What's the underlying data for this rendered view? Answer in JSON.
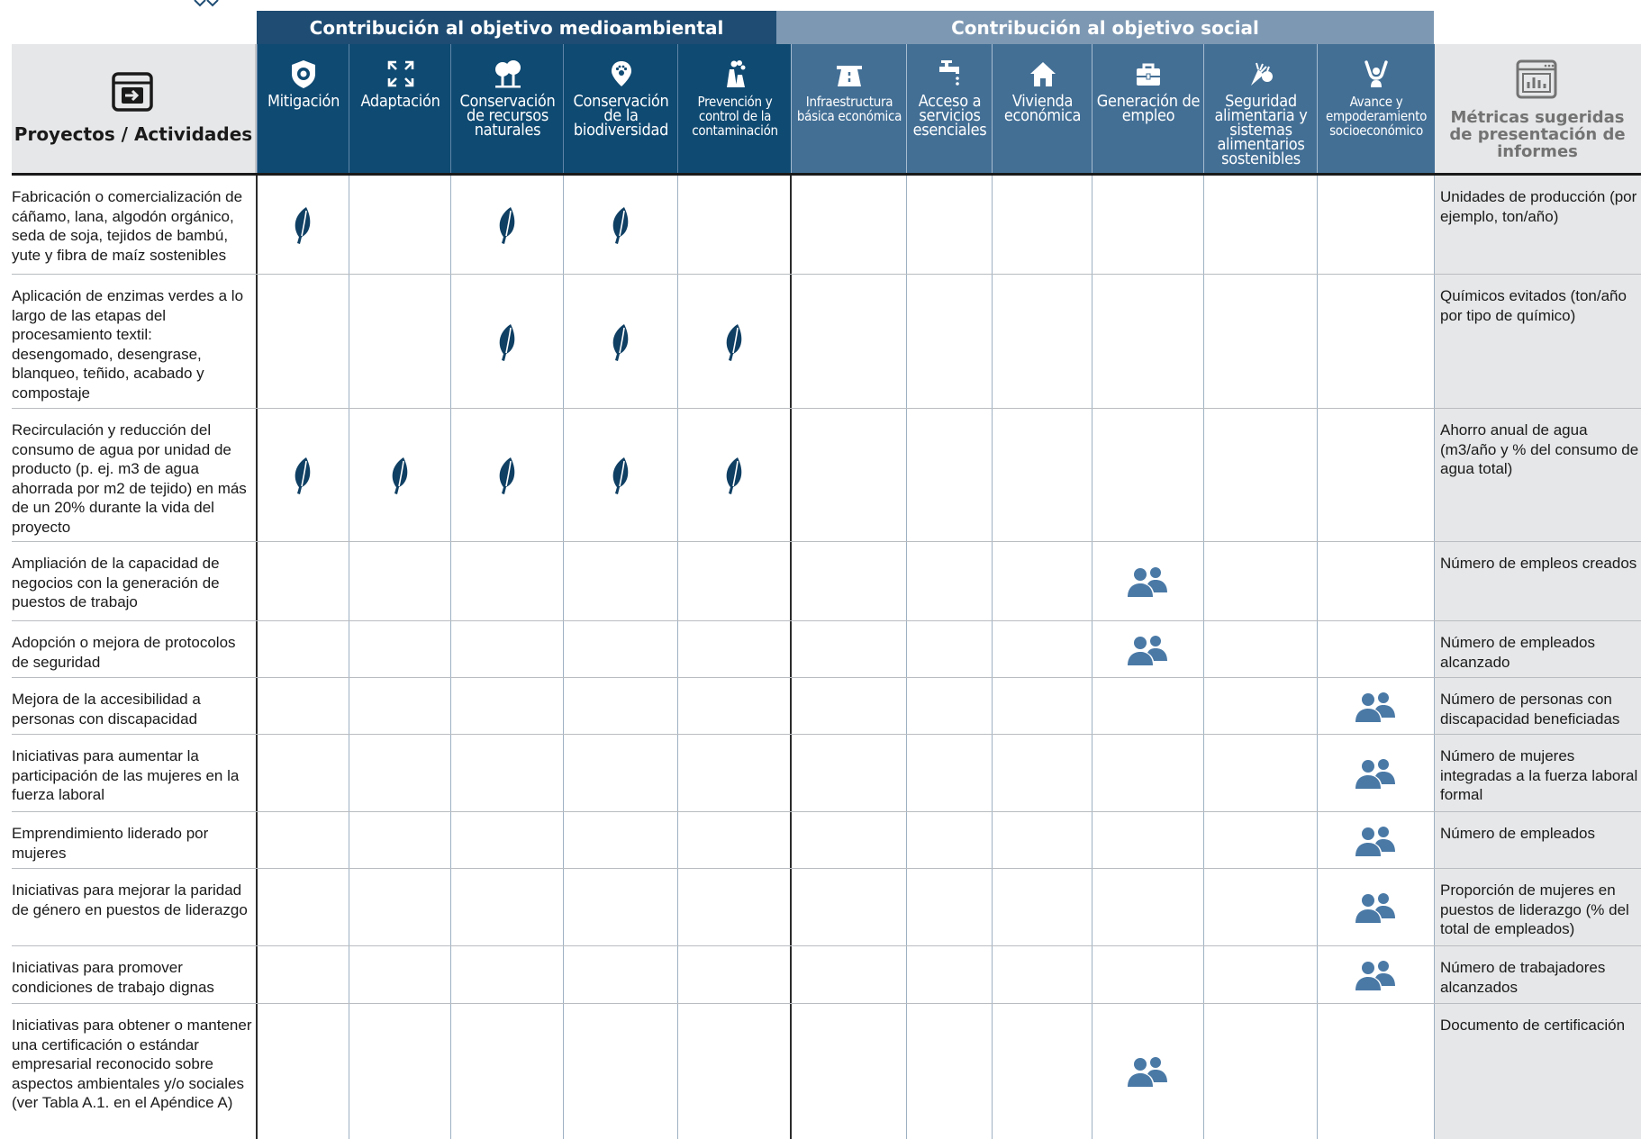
{
  "header": {
    "env_group": "Contribución al objetivo medioambiental",
    "soc_group": "Contribución al objetivo social",
    "projects_title": "Proyectos / Actividades",
    "metrics_title": "Métricas sugeridas de presentación de informes"
  },
  "columns": [
    {
      "key": "mit",
      "label": "Mitigación",
      "icon": "shield-gear-icon",
      "group": "env"
    },
    {
      "key": "ada",
      "label": "Adaptación",
      "icon": "expand-arrows-icon",
      "group": "env"
    },
    {
      "key": "rec",
      "label": "Conservación de recursos naturales",
      "icon": "trees-icon",
      "group": "env"
    },
    {
      "key": "bio",
      "label": "Conservación de la biodiversidad",
      "icon": "paw-pin-icon",
      "group": "env"
    },
    {
      "key": "pol",
      "label": "Prevención y control de la contaminación",
      "icon": "chimney-icon",
      "group": "env"
    },
    {
      "key": "inf",
      "label": "Infraestructura básica económica",
      "icon": "road-icon",
      "group": "soc"
    },
    {
      "key": "acc",
      "label": "Acceso a servicios esenciales",
      "icon": "faucet-icon",
      "group": "soc"
    },
    {
      "key": "viv",
      "label": "Vivienda económica",
      "icon": "house-icon",
      "group": "soc"
    },
    {
      "key": "emp",
      "label": "Generación de empleo",
      "icon": "briefcase-icon",
      "group": "soc"
    },
    {
      "key": "seg",
      "label": "Seguridad alimentaria y sistemas alimentarios sostenibles",
      "icon": "vegetables-icon",
      "group": "soc"
    },
    {
      "key": "ava",
      "label": "Avance y empoderamiento socioeconómico",
      "icon": "person-raised-icon",
      "group": "soc"
    }
  ],
  "rows": [
    {
      "activity": "Fabricación o comercialización de cáñamo, lana, algodón orgánico, seda de soja, tejidos de bambú, yute y fibra de maíz sostenibles",
      "metric": "Unidades de producción (por ejemplo, ton/año)",
      "env": [
        "mit",
        "rec",
        "bio"
      ],
      "soc": []
    },
    {
      "activity": "Aplicación de enzimas verdes a lo largo de las etapas del procesamiento textil: desengomado, desengrase, blanqueo, teñido, acabado y compostaje",
      "metric": "Químicos evitados (ton/año por tipo de químico)",
      "env": [
        "rec",
        "bio",
        "pol"
      ],
      "soc": []
    },
    {
      "activity": "Recirculación y reducción del consumo de agua por unidad de producto (p. ej. m3 de agua ahorrada por m2 de tejido) en más de un 20% durante la vida del proyecto",
      "metric": "Ahorro anual de agua (m3/año y % del consumo de agua total)",
      "env": [
        "mit",
        "ada",
        "rec",
        "bio",
        "pol"
      ],
      "soc": []
    },
    {
      "activity": "Ampliación de la capacidad de negocios con la generación de puestos de trabajo",
      "metric": "Número de empleos creados",
      "env": [],
      "soc": [
        "emp"
      ]
    },
    {
      "activity": "Adopción o mejora de protocolos de seguridad",
      "metric": "Número de empleados alcanzado",
      "env": [],
      "soc": [
        "emp"
      ]
    },
    {
      "activity": "Mejora de la accesibilidad a personas con discapacidad",
      "metric": "Número de personas con discapacidad beneficiadas",
      "env": [],
      "soc": [
        "ava"
      ]
    },
    {
      "activity": "Iniciativas para aumentar la participación de las mujeres en la fuerza laboral",
      "metric": "Número de mujeres integradas a la fuerza laboral formal",
      "env": [],
      "soc": [
        "ava"
      ]
    },
    {
      "activity": "Emprendimiento liderado por mujeres",
      "metric": "Número de empleados",
      "env": [],
      "soc": [
        "ava"
      ]
    },
    {
      "activity": "Iniciativas para mejorar la paridad de género en puestos de liderazgo",
      "metric": "Proporción de mujeres en puestos de liderazgo (% del total de empleados)",
      "env": [],
      "soc": [
        "ava"
      ]
    },
    {
      "activity": "Iniciativas para promover condiciones de trabajo dignas",
      "metric": "Número de trabajadores alcanzados",
      "env": [],
      "soc": [
        "ava"
      ]
    },
    {
      "activity": "Iniciativas para obtener o mantener una certificación o estándar empresarial reconocido sobre aspectos ambientales y/o sociales (ver Tabla A.1. en el Apéndice A)",
      "metric": "Documento de certificación",
      "env": [],
      "soc": [
        "emp"
      ]
    }
  ],
  "colors": {
    "env_dark": "#0f4a72",
    "env_bar": "#1e4c73",
    "soc_header": "#436f95",
    "soc_bar": "#7d98b3",
    "leaf": "#0f3f63",
    "people": "#4a79a6",
    "gray": "#e6e7e8"
  }
}
